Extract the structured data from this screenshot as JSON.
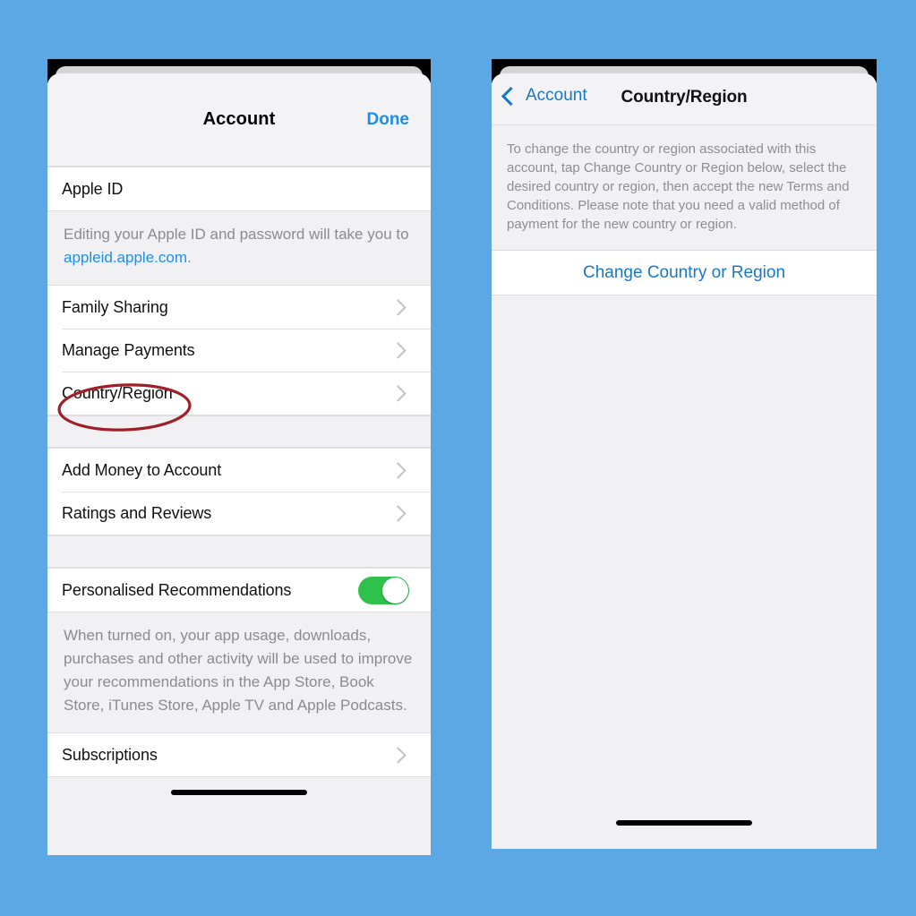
{
  "background_color": "#5ca8e4",
  "accent_blue": "#1b8ef2",
  "link_blue": "#1878c8",
  "toggle_green": "#2ec24c",
  "annotation_color": "#9e1f27",
  "left_phone": {
    "nav": {
      "title": "Account",
      "done_label": "Done"
    },
    "apple_id_row": {
      "label": "Apple ID"
    },
    "apple_id_footnote": {
      "text_before": "Editing your Apple ID and password will take you to ",
      "link": "appleid.apple.com",
      "text_after": "."
    },
    "group_one": [
      {
        "label": "Family Sharing"
      },
      {
        "label": "Manage Payments"
      },
      {
        "label": "Country/Region"
      }
    ],
    "group_two": [
      {
        "label": "Add Money to Account"
      },
      {
        "label": "Ratings and Reviews"
      }
    ],
    "recommendations_row": {
      "label": "Personalised Recommendations",
      "toggle_state": "on"
    },
    "recommendations_footnote": "When turned on, your app usage, downloads, purchases and other activity will be used to improve your recommendations in the App Store, Book Store, iTunes Store, Apple TV and Apple Podcasts.",
    "subscriptions_row": {
      "label": "Subscriptions"
    }
  },
  "right_phone": {
    "nav": {
      "back_label": "Account",
      "title": "Country/Region"
    },
    "intro_text": "To change the country or region associated with this account, tap Change Country or Region below, select the desired country or region, then accept the new Terms and Conditions. Please note that you need a valid method of payment for the new country or region.",
    "action_row": {
      "label": "Change Country or Region"
    }
  },
  "annotation": {
    "shape": "ellipse",
    "targets": "Country/Region"
  }
}
